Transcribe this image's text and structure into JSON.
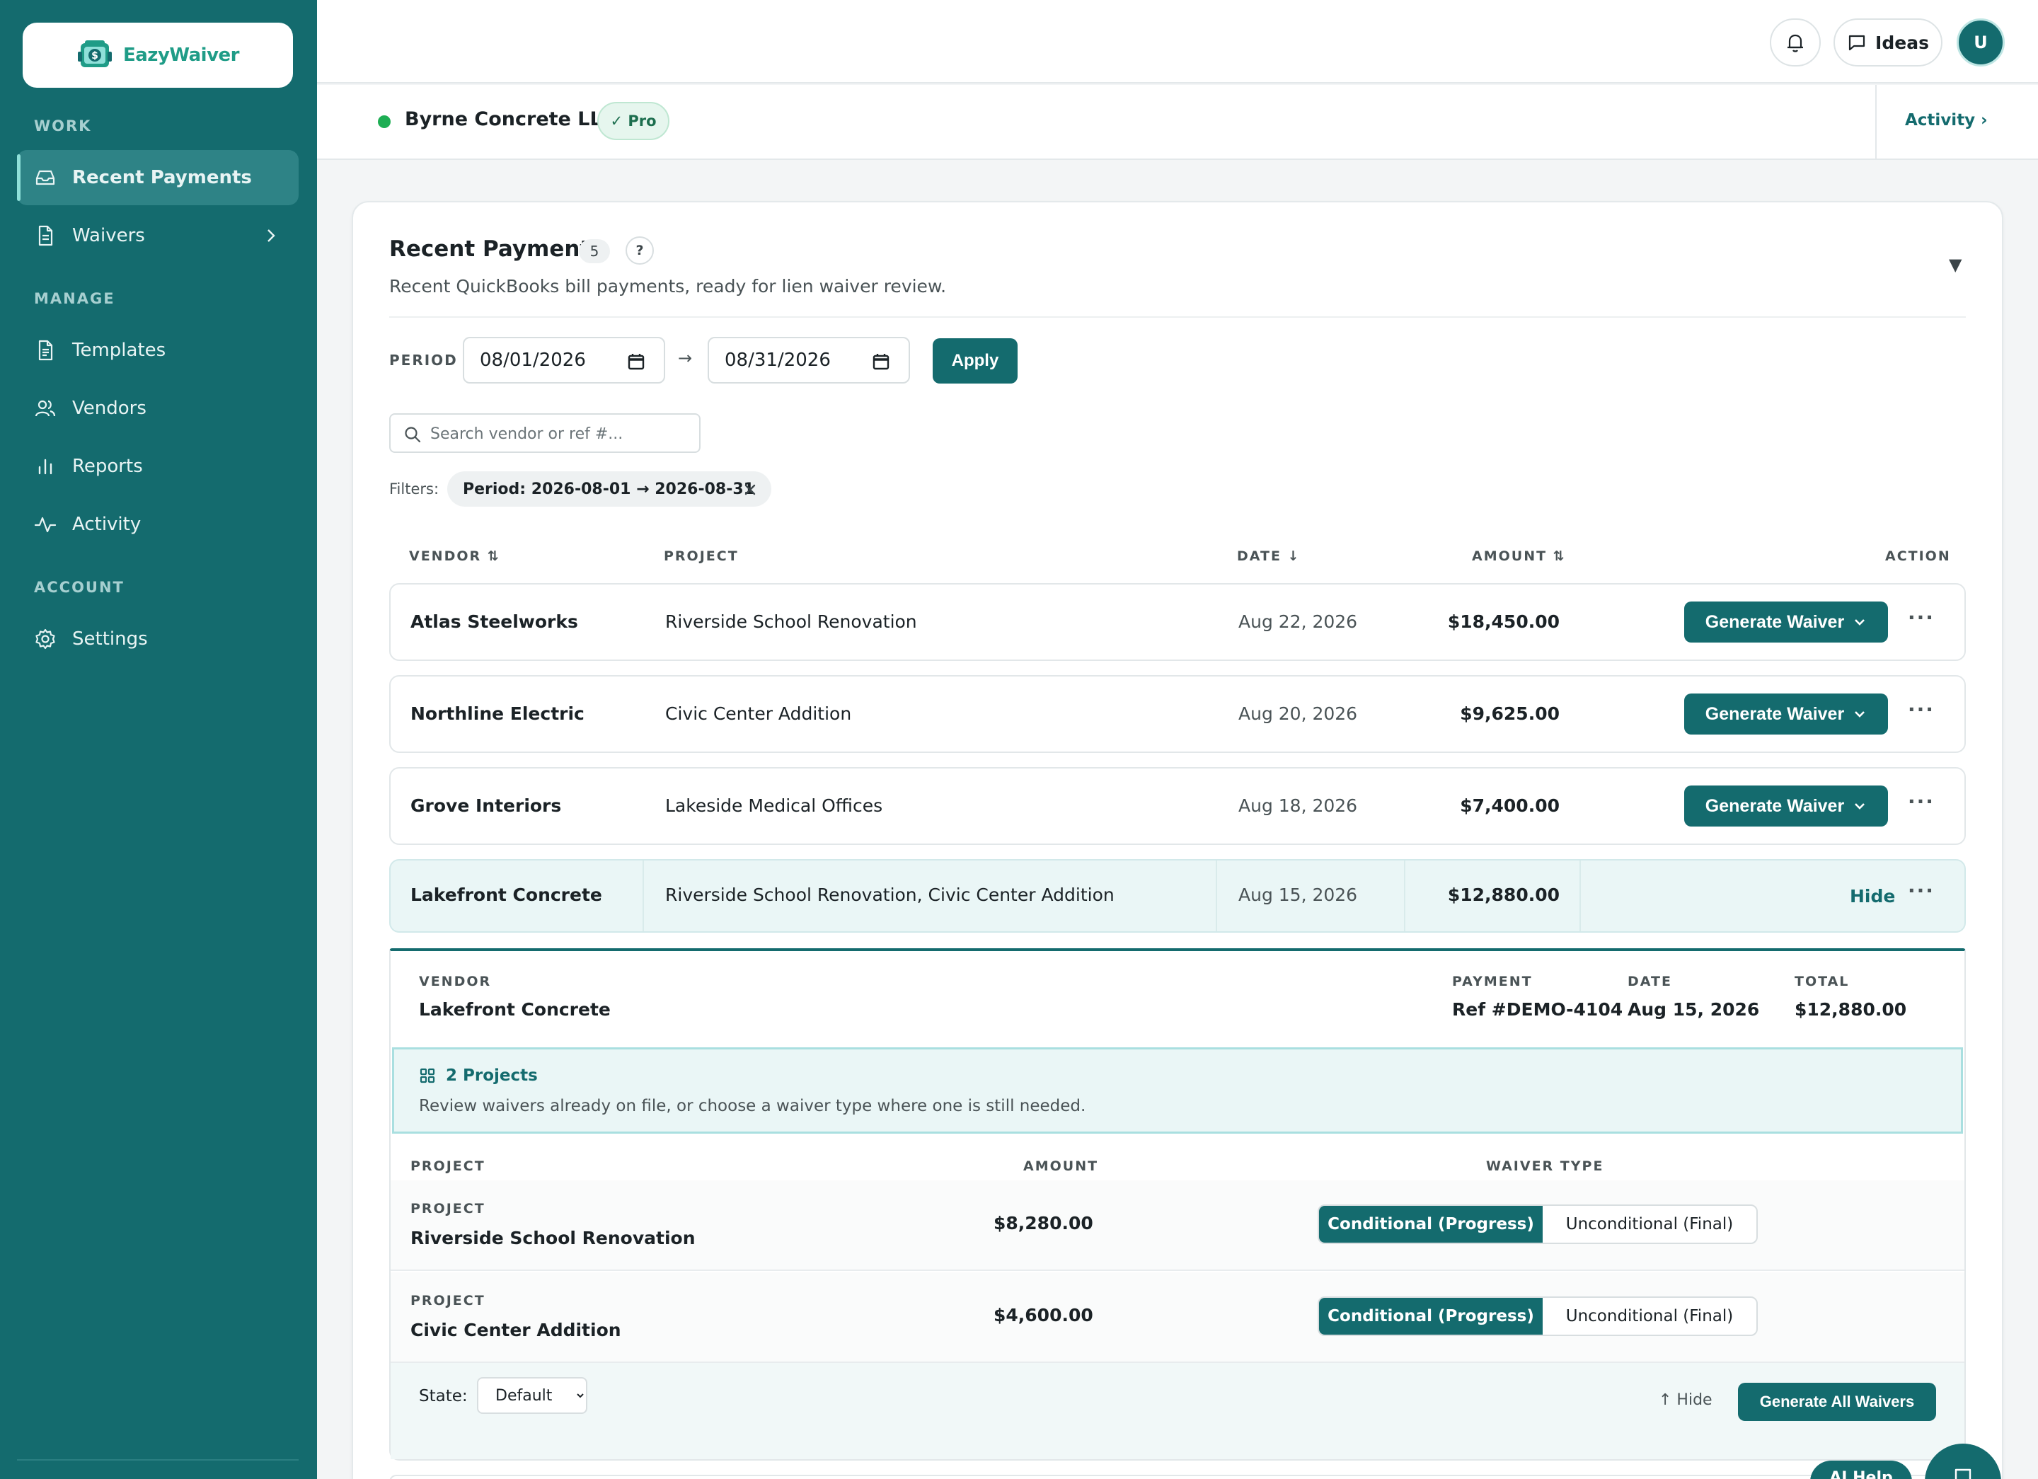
{
  "brand": {
    "name": "EazyWaiver",
    "logo_mark_text": "$"
  },
  "sidebar": {
    "sections": [
      {
        "label": "WORK",
        "items": [
          {
            "label": "Recent Payments",
            "icon": "inbox-icon",
            "active": true
          },
          {
            "label": "Waivers",
            "icon": "document-icon",
            "has_chevron": true
          }
        ]
      },
      {
        "label": "MANAGE",
        "items": [
          {
            "label": "Templates",
            "icon": "file-text-icon"
          },
          {
            "label": "Vendors",
            "icon": "users-icon"
          },
          {
            "label": "Reports",
            "icon": "bar-chart-icon"
          },
          {
            "label": "Activity",
            "icon": "pulse-icon"
          }
        ]
      },
      {
        "label": "ACCOUNT",
        "items": [
          {
            "label": "Settings",
            "icon": "gear-icon"
          }
        ]
      }
    ]
  },
  "topbar": {
    "ideas_label": "Ideas",
    "avatar_initial": "U"
  },
  "company": {
    "name": "Byrne Concrete LLC",
    "plan_badge": "✓ Pro",
    "activity_link": "Activity ›"
  },
  "card": {
    "title": "Recent Payments",
    "count": "5",
    "help": "?",
    "subtitle": "Recent QuickBooks bill payments, ready for lien waiver review.",
    "collapse": "▼"
  },
  "period": {
    "label": "PERIOD",
    "from": "08/01/2026",
    "to": "08/31/2026",
    "arrow": "→",
    "apply_label": "Apply"
  },
  "search": {
    "placeholder": "Search vendor or ref #..."
  },
  "filters": {
    "label": "Filters:",
    "chip": "Period: 2026-08-01 → 2026-08-31"
  },
  "table": {
    "headers": {
      "vendor": "VENDOR ⇅",
      "project": "PROJECT",
      "date": "DATE ↓",
      "amount": "AMOUNT ⇅",
      "action": "ACTION"
    },
    "rows": [
      {
        "vendor": "Atlas Steelworks",
        "project": "Riverside School Renovation",
        "date": "Aug 22, 2026",
        "amount": "$18,450.00",
        "action": "Generate Waiver"
      },
      {
        "vendor": "Northline Electric",
        "project": "Civic Center Addition",
        "date": "Aug 20, 2026",
        "amount": "$9,625.00",
        "action": "Generate Waiver"
      },
      {
        "vendor": "Grove Interiors",
        "project": "Lakeside Medical Offices",
        "date": "Aug 18, 2026",
        "amount": "$7,400.00",
        "action": "Generate Waiver"
      },
      {
        "vendor": "Lakefront Concrete",
        "project": "Riverside School Renovation, Civic Center Addition",
        "date": "Aug 15, 2026",
        "amount": "$12,880.00",
        "action": "Hide"
      }
    ],
    "more": "···"
  },
  "detail": {
    "vendor_label": "VENDOR",
    "vendor": "Lakefront Concrete",
    "payment_label": "PAYMENT",
    "payment": "Ref #DEMO-4104",
    "date_label": "DATE",
    "date": "Aug 15, 2026",
    "total_label": "TOTAL",
    "total": "$12,880.00",
    "projects_title": "2 Projects",
    "projects_sub": "Review waivers already on file, or choose a waiver type where one is still needed.",
    "headers": {
      "project": "PROJECT",
      "amount": "AMOUNT",
      "waiver_type": "WAIVER TYPE"
    },
    "projects": [
      {
        "label": "PROJECT",
        "name": "Riverside School Renovation",
        "amount": "$8,280.00",
        "options": [
          "Conditional (Progress)",
          "Unconditional (Final)"
        ],
        "selected": 0
      },
      {
        "label": "PROJECT",
        "name": "Civic Center Addition",
        "amount": "$4,600.00",
        "options": [
          "Conditional (Progress)",
          "Unconditional (Final)"
        ],
        "selected": 0
      }
    ],
    "state_label": "State:",
    "state_value": "Default",
    "hide_label": "↑ Hide",
    "generate_all_label": "Generate All Waivers"
  },
  "floating": {
    "ai_help": "AI Help"
  },
  "colors": {
    "primary": "#146b6e",
    "success": "#1eae54",
    "accent": "#8fe0d9"
  }
}
